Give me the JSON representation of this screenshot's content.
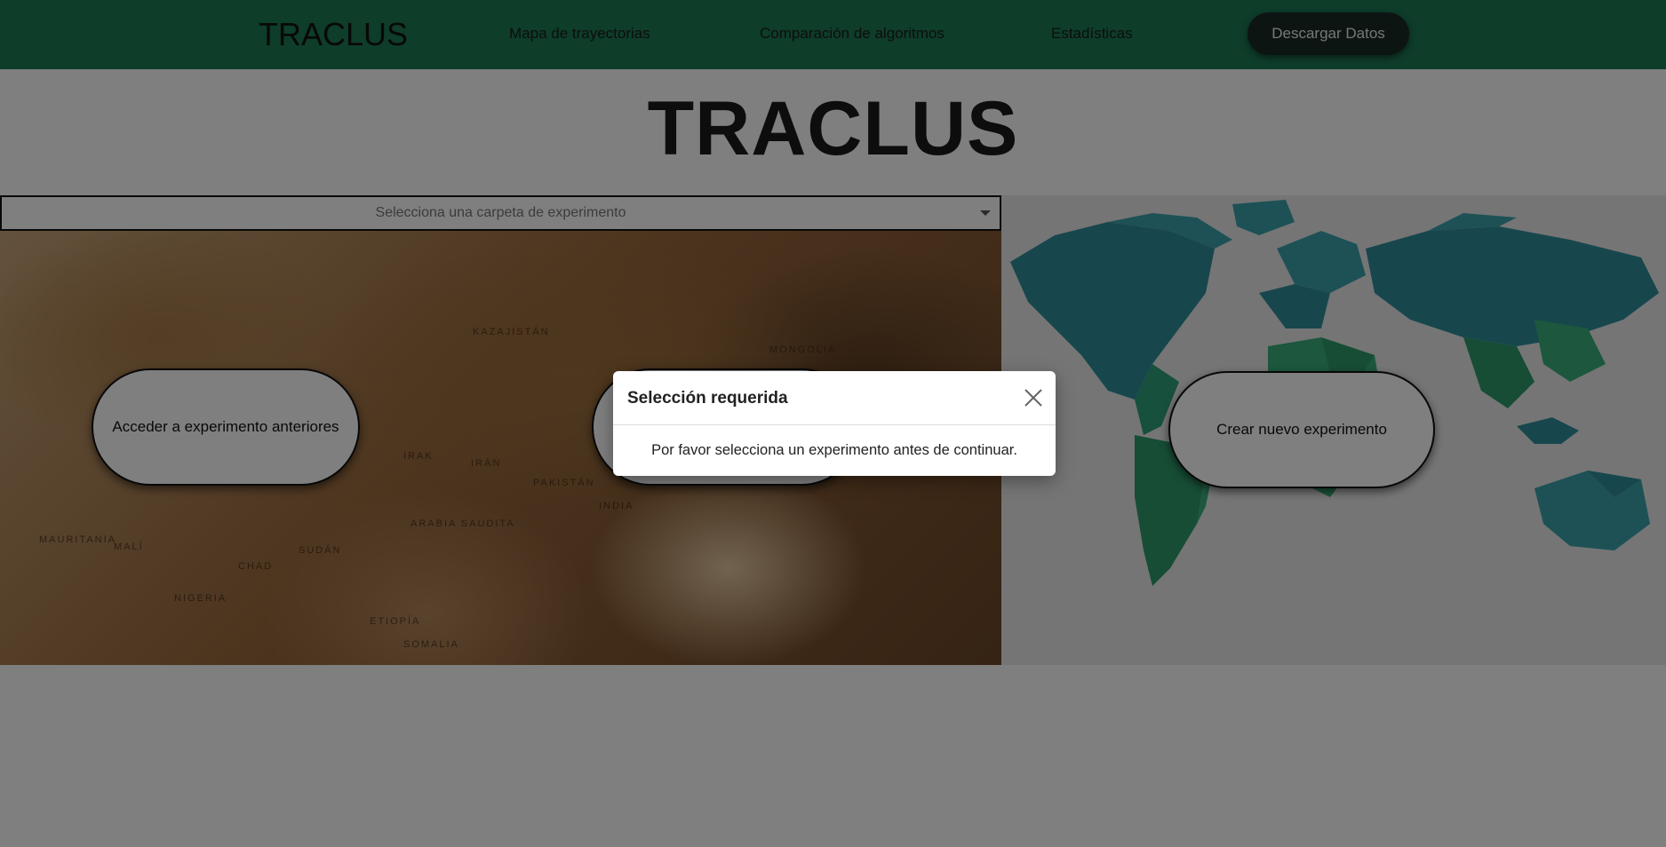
{
  "navbar": {
    "brand": "TRACLUS",
    "links": [
      "Mapa de trayectorias",
      "Comparación de algoritmos",
      "Estadísticas"
    ],
    "download_label": "Descargar Datos",
    "color": "#1d7a55"
  },
  "main": {
    "title": "TRACLUS",
    "folder_select": {
      "placeholder": "Selecciona una carpeta de experimento"
    },
    "buttons": {
      "previous": "Acceder a experimento anteriores",
      "new": "Crear nuevo experimento"
    },
    "map_labels": [
      "KAZAJISTÁN",
      "MONGOLIA",
      "IRÁN",
      "INDIA",
      "ARABIA SAUDITA",
      "SUDÁN",
      "MALÍ",
      "CHAD",
      "NIGERIA",
      "MAURITANIA",
      "ETIOPÍA",
      "SOMALIA",
      "PAKISTÁN",
      "IRAK"
    ]
  },
  "modal": {
    "title": "Selección requerida",
    "message": "Por favor selecciona un experimento antes de continuar.",
    "close_icon": "close-icon"
  }
}
